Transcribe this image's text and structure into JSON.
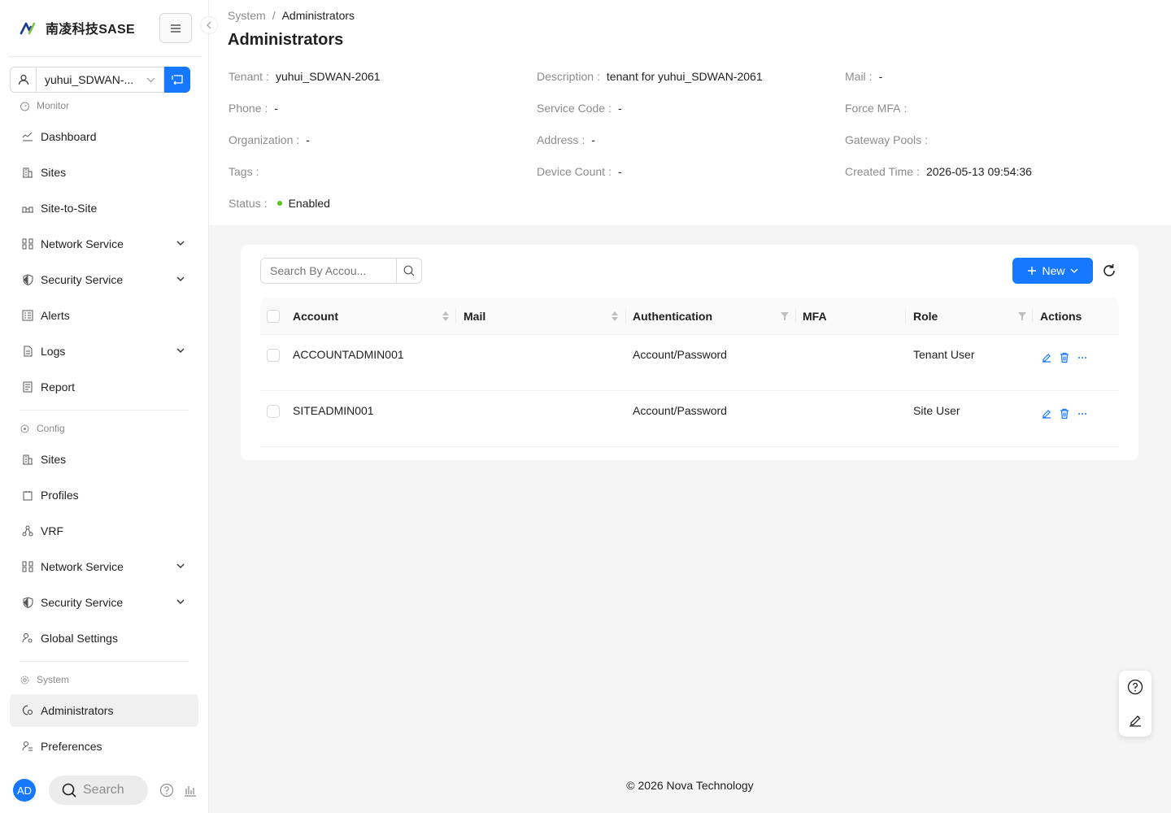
{
  "app": {
    "logo_text": "南凌科技SASE"
  },
  "sidebar": {
    "tenant_value": "yuhui_SDWAN-...",
    "groups": {
      "monitor": "Monitor",
      "config": "Config",
      "system": "System"
    },
    "monitor_items": [
      "Dashboard",
      "Sites",
      "Site-to-Site",
      "Network Service",
      "Security Service",
      "Alerts",
      "Logs",
      "Report"
    ],
    "config_items": [
      "Sites",
      "Profiles",
      "VRF",
      "Network Service",
      "Security Service",
      "Global Settings"
    ],
    "system_items": [
      "Administrators",
      "Preferences"
    ],
    "active_item": "Administrators",
    "avatar_initials": "AD",
    "search_label": "Search"
  },
  "breadcrumb": {
    "parent": "System",
    "separator": "/",
    "current": "Administrators"
  },
  "page": {
    "title": "Administrators"
  },
  "tenant_info": {
    "tenant_label": "Tenant",
    "tenant_value": "yuhui_SDWAN-2061",
    "description_label": "Description",
    "description_value": "tenant for yuhui_SDWAN-2061",
    "mail_label": "Mail",
    "mail_value": "-",
    "phone_label": "Phone",
    "phone_value": "-",
    "service_code_label": "Service Code",
    "service_code_value": "-",
    "force_mfa_label": "Force MFA",
    "organization_label": "Organization",
    "organization_value": "-",
    "address_label": "Address",
    "address_value": "-",
    "gateway_pools_label": "Gateway Pools",
    "tags_label": "Tags",
    "device_count_label": "Device Count",
    "device_count_value": "-",
    "created_time_label": "Created Time",
    "created_time_value": "2026-05-13 09:54:36",
    "status_label": "Status",
    "status_value": "Enabled",
    "colon": ":"
  },
  "toolbar": {
    "search_placeholder": "Search By Accou...",
    "new_label": "New"
  },
  "table": {
    "columns": [
      "Account",
      "Mail",
      "Authentication",
      "MFA",
      "Role",
      "Actions"
    ],
    "rows": [
      {
        "account": "ACCOUNTADMIN001",
        "mail": "",
        "authentication": "Account/Password",
        "mfa": "",
        "role": "Tenant User"
      },
      {
        "account": "SITEADMIN001",
        "mail": "",
        "authentication": "Account/Password",
        "mfa": "",
        "role": "Site User"
      }
    ]
  },
  "footer": {
    "text": "© 2026 Nova Technology"
  },
  "colors": {
    "primary": "#1677ff",
    "status_enabled": "#52c41a"
  }
}
